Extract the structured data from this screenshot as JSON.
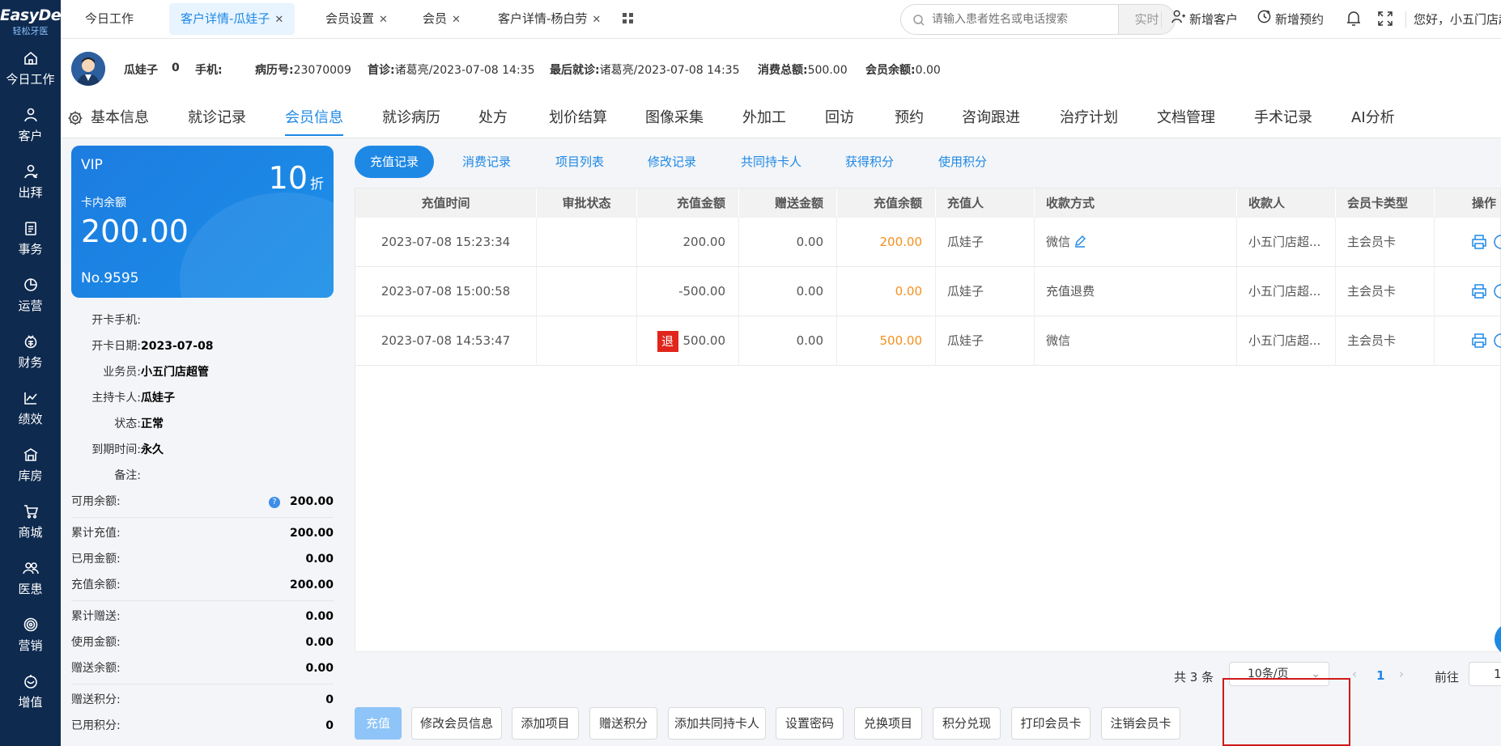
{
  "logo": {
    "line1": "EasyDent",
    "line2": "轻松牙医"
  },
  "sidebar": [
    {
      "label": "今日工作",
      "icon": "home-icon"
    },
    {
      "label": "客户",
      "icon": "user-icon"
    },
    {
      "label": "出拜",
      "icon": "visit-icon"
    },
    {
      "label": "事务",
      "icon": "task-icon"
    },
    {
      "label": "运营",
      "icon": "pie-icon"
    },
    {
      "label": "财务",
      "icon": "wallet-icon"
    },
    {
      "label": "绩效",
      "icon": "chart-icon"
    },
    {
      "label": "库房",
      "icon": "warehouse-icon"
    },
    {
      "label": "商城",
      "icon": "cart-icon"
    },
    {
      "label": "医患",
      "icon": "people-icon"
    },
    {
      "label": "营销",
      "icon": "target-icon"
    },
    {
      "label": "增值",
      "icon": "value-icon"
    }
  ],
  "tabs": [
    {
      "label": "今日工作",
      "close": false
    },
    {
      "label": "客户详情-瓜娃子",
      "close": true,
      "active": true
    },
    {
      "label": "会员设置",
      "close": true
    },
    {
      "label": "会员",
      "close": true
    },
    {
      "label": "客户详情-杨白劳",
      "close": true
    }
  ],
  "search": {
    "placeholder": "请输入患者姓名或电话搜索",
    "realtime": "实时"
  },
  "header_actions": {
    "add_customer": "新增客户",
    "add_appointment": "新增预约",
    "greeting": "您好，小五门店超"
  },
  "patient": {
    "name": "瓜娃子",
    "age": "0",
    "phone_label": "手机:",
    "phone": "",
    "record_label": "病历号:",
    "record": "23070009",
    "first_label": "首诊:",
    "first": "诸葛亮/2023-07-08 14:35",
    "last_label": "最后就诊:",
    "last": "诸葛亮/2023-07-08 14:35",
    "total_label": "消费总额:",
    "total": "500.00",
    "balance_label": "会员余额:",
    "balance": "0.00"
  },
  "main_tabs": [
    "基本信息",
    "就诊记录",
    "会员信息",
    "就诊病历",
    "处方",
    "划价结算",
    "图像采集",
    "外加工",
    "回访",
    "预约",
    "咨询跟进",
    "治疗计划",
    "文档管理",
    "手术记录",
    "AI分析"
  ],
  "card": {
    "vip": "VIP",
    "discount": "10",
    "discount_unit": "折",
    "balance_label": "卡内余额",
    "balance": "200.00",
    "number": "No.9595"
  },
  "card_info": [
    {
      "label": "开卡手机:",
      "value": ""
    },
    {
      "label": "开卡日期:",
      "value": "2023-07-08"
    },
    {
      "label": "业务员:",
      "value": "小五门店超管"
    },
    {
      "label": "主持卡人:",
      "value": "瓜娃子"
    },
    {
      "label": "状态:",
      "value": "正常"
    },
    {
      "label": "到期时间:",
      "value": "永久"
    },
    {
      "label": "备注:",
      "value": ""
    }
  ],
  "amounts": {
    "available_label": "可用余额:",
    "available": "200.00",
    "qmark": "?",
    "g1": [
      {
        "label": "累计充值:",
        "value": "200.00"
      },
      {
        "label": "已用金额:",
        "value": "0.00"
      },
      {
        "label": "充值余额:",
        "value": "200.00"
      }
    ],
    "g2": [
      {
        "label": "累计赠送:",
        "value": "0.00"
      },
      {
        "label": "使用金额:",
        "value": "0.00"
      },
      {
        "label": "赠送余额:",
        "value": "0.00"
      }
    ],
    "g3": [
      {
        "label": "赠送积分:",
        "value": "0"
      },
      {
        "label": "已用积分:",
        "value": "0"
      }
    ]
  },
  "sub_tabs": [
    "充值记录",
    "消费记录",
    "项目列表",
    "修改记录",
    "共同持卡人",
    "获得积分",
    "使用积分"
  ],
  "table": {
    "headers": [
      "充值时间",
      "审批状态",
      "充值金额",
      "赠送金额",
      "充值余额",
      "充值人",
      "收款方式",
      "收款人",
      "会员卡类型",
      "操作"
    ],
    "rows": [
      {
        "time": "2023-07-08 15:23:34",
        "status": "",
        "amount": "200.00",
        "gift": "0.00",
        "balance": "200.00",
        "payer": "瓜娃子",
        "method": "微信",
        "receiver": "小五门店超...",
        "type": "主会员卡",
        "refund": ""
      },
      {
        "time": "2023-07-08 15:00:58",
        "status": "",
        "amount": "-500.00",
        "gift": "0.00",
        "balance": "0.00",
        "payer": "瓜娃子",
        "method": "充值退费",
        "receiver": "小五门店超...",
        "type": "主会员卡",
        "refund": ""
      },
      {
        "time": "2023-07-08 14:53:47",
        "status": "",
        "amount": "500.00",
        "gift": "0.00",
        "balance": "500.00",
        "payer": "瓜娃子",
        "method": "微信",
        "receiver": "小五门店超...",
        "type": "主会员卡",
        "refund": "退"
      }
    ]
  },
  "pager": {
    "total": "共 3 条",
    "page_size": "10条/页",
    "page": "1",
    "goto_label": "前往",
    "goto_value": "1"
  },
  "actions": [
    "充值",
    "修改会员信息",
    "添加项目",
    "赠送积分",
    "添加共同持卡人",
    "设置密码",
    "兑换项目",
    "积分兑现",
    "打印会员卡",
    "注销会员卡"
  ],
  "colors": {
    "sidebar": "#0e2a4f",
    "accent": "#1e88e5",
    "orange": "#f5901e",
    "refund": "#e0251b",
    "highlight": "#d01818"
  }
}
